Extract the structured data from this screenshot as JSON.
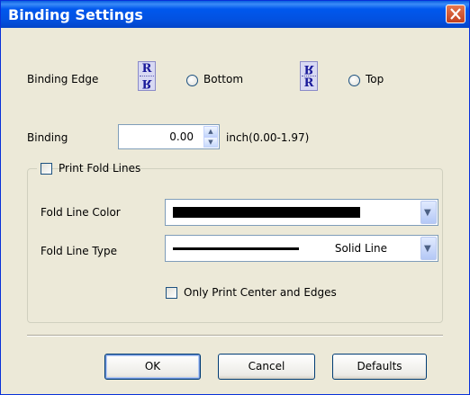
{
  "window": {
    "title": "Binding Settings",
    "close_icon": "close-icon"
  },
  "binding_edge": {
    "label": "Binding Edge",
    "options": [
      {
        "label": "Bottom",
        "selected": false,
        "icon": "binding-bottom-icon"
      },
      {
        "label": "Top",
        "selected": false,
        "icon": "binding-top-icon"
      }
    ],
    "icon_letter": "R"
  },
  "binding": {
    "label": "Binding",
    "value": "0.00",
    "unit_range": "inch(0.00-1.97)"
  },
  "fold_lines": {
    "checkbox_label": "Print Fold Lines",
    "checked": false,
    "color_label": "Fold Line Color",
    "color_value": "#000000",
    "type_label": "Fold Line Type",
    "type_value": "Solid Line",
    "center_edges_label": "Only Print Center and Edges",
    "center_edges_checked": false
  },
  "buttons": {
    "ok": "OK",
    "cancel": "Cancel",
    "defaults": "Defaults"
  }
}
